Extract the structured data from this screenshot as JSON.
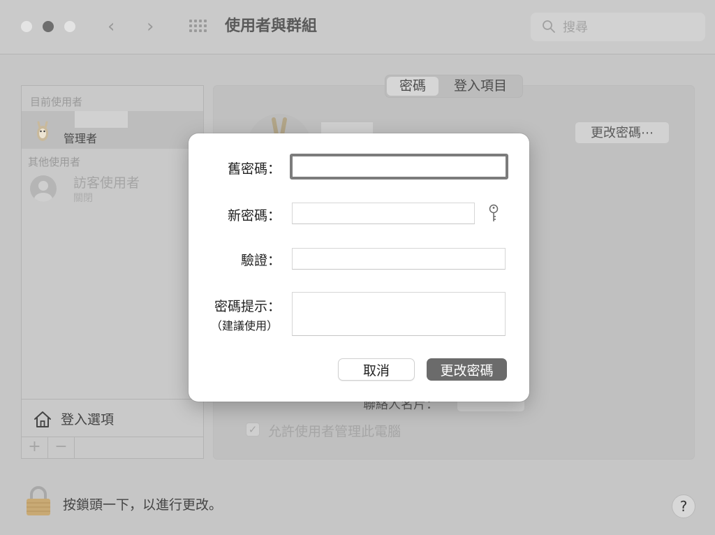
{
  "window": {
    "title": "使用者與群組",
    "nav_back": "‹",
    "nav_forward": "›"
  },
  "search": {
    "placeholder": "搜尋"
  },
  "sidebar": {
    "current_users_header": "目前使用者",
    "admin_role": "管理者",
    "other_users_header": "其他使用者",
    "guest_name": "訪客使用者",
    "guest_status": "關閉",
    "login_options": "登入選項",
    "add_label": "+",
    "remove_label": "−"
  },
  "main": {
    "tabs": [
      {
        "label": "密碼",
        "selected": true
      },
      {
        "label": "登入項目",
        "selected": false
      }
    ],
    "change_password_button": "更改密碼⋯",
    "allow_admin_label": "允許使用者管理此電腦",
    "allow_admin_checked": true,
    "contact_card_label": "聯絡人名片："
  },
  "footer": {
    "lock_text": "按鎖頭一下，以進行更改。",
    "help_label": "?"
  },
  "dialog": {
    "old_password_label": "舊密碼：",
    "new_password_label": "新密碼：",
    "verify_label": "驗證：",
    "hint_label": "密碼提示：",
    "hint_sublabel": "（建議使用）",
    "cancel_button": "取消",
    "ok_button": "更改密碼",
    "old_password_value": "",
    "new_password_value": "",
    "verify_value": "",
    "hint_value": ""
  },
  "colors": {
    "dim_background": "#c6c6c6",
    "dialog_background": "#ffffff",
    "primary_button": "#6b6b6b",
    "focus_ring": "#7c7c7c"
  }
}
